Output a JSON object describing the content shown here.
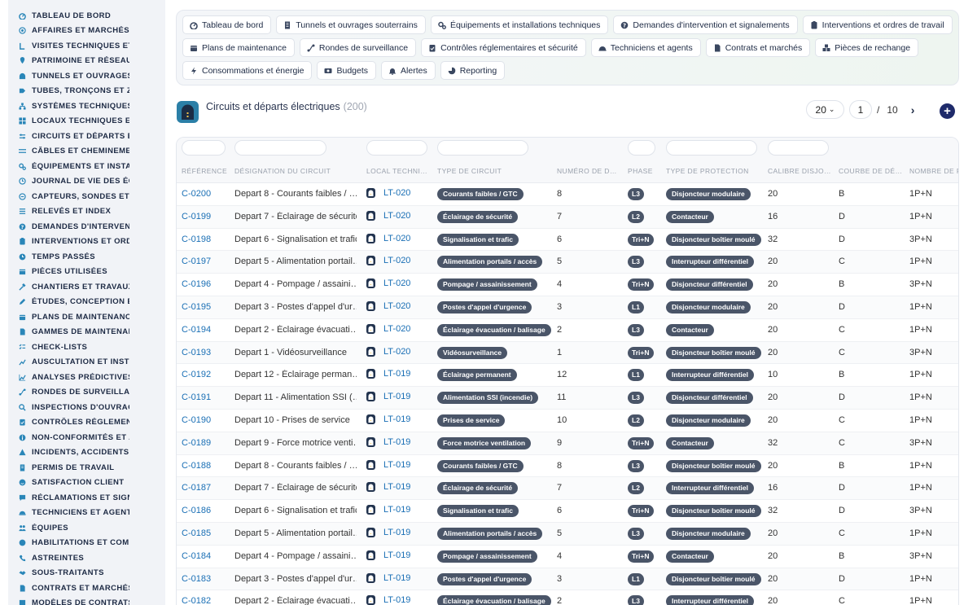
{
  "sidebar": {
    "items": [
      {
        "label": "TABLEAU DE BORD",
        "icon": "dashboard-icon"
      },
      {
        "label": "AFFAIRES ET MARCHÉS",
        "icon": "target-icon"
      },
      {
        "label": "VISITES TECHNIQUES ET",
        "icon": "footprint-icon"
      },
      {
        "label": "PATRIMOINE ET RÉSEAUX",
        "icon": "map-pin-icon"
      },
      {
        "label": "TUNNELS ET OUVRAGES",
        "icon": "tunnel-icon"
      },
      {
        "label": "TUBES, TRONÇONS ET ZO",
        "icon": "road-icon"
      },
      {
        "label": "SYSTÈMES TECHNIQUES",
        "icon": "network-icon"
      },
      {
        "label": "LOCAUX TECHNIQUES ET",
        "icon": "grid-icon"
      },
      {
        "label": "CIRCUITS ET DÉPARTS ÉL",
        "icon": "circuit-icon"
      },
      {
        "label": "CÂBLES ET CHEMINEMENT",
        "icon": "cable-icon"
      },
      {
        "label": "ÉQUIPEMENTS ET INSTAL",
        "icon": "gears-icon"
      },
      {
        "label": "JOURNAL DE VIE DES ÉQ",
        "icon": "history-icon"
      },
      {
        "label": "CAPTEURS, SONDES ET C",
        "icon": "sensor-icon"
      },
      {
        "label": "RELEVÉS ET INDEX",
        "icon": "list-icon"
      },
      {
        "label": "DEMANDES D'INTERVENT",
        "icon": "question-icon"
      },
      {
        "label": "INTERVENTIONS ET ORDR",
        "icon": "clipboard-icon"
      },
      {
        "label": "TEMPS PASSÉS",
        "icon": "clock-icon"
      },
      {
        "label": "PIÈCES UTILISÉES",
        "icon": "box-icon"
      },
      {
        "label": "CHANTIERS ET TRAVAUX",
        "icon": "hammer-icon"
      },
      {
        "label": "ÉTUDES, CONCEPTION ET",
        "icon": "pencil-icon"
      },
      {
        "label": "PLANS DE MAINTENANCE",
        "icon": "calendar-icon"
      },
      {
        "label": "GAMMES DE MAINTENANC",
        "icon": "document-icon"
      },
      {
        "label": "CHECK-LISTS",
        "icon": "checklist-icon"
      },
      {
        "label": "AUSCULTATION ET INSTR",
        "icon": "chart-icon"
      },
      {
        "label": "ANALYSES PRÉDICTIVES",
        "icon": "trend-icon"
      },
      {
        "label": "RONDES DE SURVEILLAN",
        "icon": "route-icon"
      },
      {
        "label": "INSPECTIONS D'OUVRAGE",
        "icon": "magnifier-icon"
      },
      {
        "label": "CONTRÔLES RÉGLEMENT",
        "icon": "clipboard-check-icon"
      },
      {
        "label": "NON-CONFORMITÉS ET A",
        "icon": "info-icon"
      },
      {
        "label": "INCIDENTS, ACCIDENTS E",
        "icon": "warning-icon"
      },
      {
        "label": "PERMIS DE TRAVAIL",
        "icon": "permit-icon"
      },
      {
        "label": "SATISFACTION CLIENT",
        "icon": "smile-icon"
      },
      {
        "label": "RÉCLAMATIONS ET SIGNA",
        "icon": "chat-icon"
      },
      {
        "label": "TECHNICIENS ET AGENTS",
        "icon": "helmet-icon"
      },
      {
        "label": "ÉQUIPES",
        "icon": "team-icon"
      },
      {
        "label": "HABILITATIONS ET COMP",
        "icon": "badge-icon"
      },
      {
        "label": "ASTREINTES",
        "icon": "phone-icon"
      },
      {
        "label": "SOUS-TRAITANTS",
        "icon": "handshake-icon"
      },
      {
        "label": "CONTRATS ET MARCHÉS",
        "icon": "contract-icon"
      },
      {
        "label": "MODÈLES DE CONTRATS",
        "icon": "template-icon"
      }
    ]
  },
  "topnav": {
    "rows": [
      [
        {
          "label": "Tableau de bord",
          "icon": "dashboard-icon"
        },
        {
          "label": "Tunnels et ouvrages souterrains",
          "icon": "building-icon"
        },
        {
          "label": "Équipements et installations techniques",
          "icon": "gears-icon"
        },
        {
          "label": "Demandes d'intervention et signalements",
          "icon": "question-icon"
        },
        {
          "label": "Interventions et ordres de travail",
          "icon": "clipboard-icon"
        }
      ],
      [
        {
          "label": "Plans de maintenance",
          "icon": "calendar-icon"
        },
        {
          "label": "Rondes de surveillance",
          "icon": "route-icon"
        },
        {
          "label": "Contrôles réglementaires et sécurité",
          "icon": "clipboard-check-icon"
        },
        {
          "label": "Techniciens et agents",
          "icon": "helmet-icon"
        },
        {
          "label": "Contrats et marchés",
          "icon": "contract-icon"
        },
        {
          "label": "Pièces de rechange",
          "icon": "parts-icon"
        }
      ],
      [
        {
          "label": "Consommations et énergie",
          "icon": "bolt-icon"
        },
        {
          "label": "Budgets",
          "icon": "money-icon"
        },
        {
          "label": "Alertes",
          "icon": "bell-icon"
        },
        {
          "label": "Reporting",
          "icon": "pie-icon"
        }
      ]
    ]
  },
  "page": {
    "title": "Circuits et départs électriques",
    "count": "(200)",
    "logo_icon": "tunnel-logo-icon"
  },
  "pagination": {
    "page_size": "20",
    "current_page": "1",
    "separator": "/",
    "total_pages": "10",
    "next_icon": "chevron-right-icon",
    "add_icon": "plus-circle-icon"
  },
  "table": {
    "columns": [
      "RÉFÉRENCE",
      "DÉSIGNATION DU CIRCUIT",
      "LOCAL TECHNI…",
      "TYPE DE CIRCUIT",
      "NUMÉRO DE D…",
      "PHASE",
      "TYPE DE PROTECTION",
      "CALIBRE DISJO…",
      "COURBE DE DÉ…",
      "NOMBRE DE P"
    ],
    "rows": [
      {
        "ref": "C-0200",
        "designation": "Depart 8 - Courants faibles / …",
        "local": "LT-020",
        "type": "Courants faibles / GTC",
        "num": "8",
        "phase": "L3",
        "protection": "Disjoncteur modulaire",
        "calibre": "20",
        "courbe": "B",
        "poles": "1P+N"
      },
      {
        "ref": "C-0199",
        "designation": "Depart 7 - Éclairage de sécurité",
        "local": "LT-020",
        "type": "Éclairage de sécurité",
        "num": "7",
        "phase": "L2",
        "protection": "Contacteur",
        "calibre": "16",
        "courbe": "D",
        "poles": "1P+N"
      },
      {
        "ref": "C-0198",
        "designation": "Depart 6 - Signalisation et trafic",
        "local": "LT-020",
        "type": "Signalisation et trafic",
        "num": "6",
        "phase": "Tri+N",
        "protection": "Disjoncteur boîtier moulé",
        "calibre": "32",
        "courbe": "D",
        "poles": "3P+N"
      },
      {
        "ref": "C-0197",
        "designation": "Depart 5 - Alimentation portail…",
        "local": "LT-020",
        "type": "Alimentation portails / accès",
        "num": "5",
        "phase": "L3",
        "protection": "Interrupteur différentiel",
        "calibre": "20",
        "courbe": "C",
        "poles": "1P+N"
      },
      {
        "ref": "C-0196",
        "designation": "Depart 4 - Pompage / assaini…",
        "local": "LT-020",
        "type": "Pompage / assainissement",
        "num": "4",
        "phase": "Tri+N",
        "protection": "Disjoncteur différentiel",
        "calibre": "20",
        "courbe": "B",
        "poles": "3P+N"
      },
      {
        "ref": "C-0195",
        "designation": "Depart 3 - Postes d'appel d'ur…",
        "local": "LT-020",
        "type": "Postes d'appel d'urgence",
        "num": "3",
        "phase": "L1",
        "protection": "Disjoncteur modulaire",
        "calibre": "20",
        "courbe": "D",
        "poles": "1P+N"
      },
      {
        "ref": "C-0194",
        "designation": "Depart 2 - Éclairage évacuati…",
        "local": "LT-020",
        "type": "Éclairage évacuation / balisage",
        "num": "2",
        "phase": "L3",
        "protection": "Contacteur",
        "calibre": "20",
        "courbe": "C",
        "poles": "1P+N"
      },
      {
        "ref": "C-0193",
        "designation": "Depart 1 - Vidéosurveillance",
        "local": "LT-020",
        "type": "Vidéosurveillance",
        "num": "1",
        "phase": "Tri+N",
        "protection": "Disjoncteur boîtier moulé",
        "calibre": "20",
        "courbe": "C",
        "poles": "3P+N"
      },
      {
        "ref": "C-0192",
        "designation": "Depart 12 - Éclairage perman…",
        "local": "LT-019",
        "type": "Éclairage permanent",
        "num": "12",
        "phase": "L1",
        "protection": "Interrupteur différentiel",
        "calibre": "10",
        "courbe": "B",
        "poles": "1P+N"
      },
      {
        "ref": "C-0191",
        "designation": "Depart 11 - Alimentation SSI (…",
        "local": "LT-019",
        "type": "Alimentation SSI (incendie)",
        "num": "11",
        "phase": "L3",
        "protection": "Disjoncteur différentiel",
        "calibre": "20",
        "courbe": "D",
        "poles": "1P+N"
      },
      {
        "ref": "C-0190",
        "designation": "Depart 10 - Prises de service",
        "local": "LT-019",
        "type": "Prises de service",
        "num": "10",
        "phase": "L2",
        "protection": "Disjoncteur modulaire",
        "calibre": "20",
        "courbe": "C",
        "poles": "1P+N"
      },
      {
        "ref": "C-0189",
        "designation": "Depart 9 - Force motrice venti…",
        "local": "LT-019",
        "type": "Force motrice ventilation",
        "num": "9",
        "phase": "Tri+N",
        "protection": "Contacteur",
        "calibre": "32",
        "courbe": "C",
        "poles": "3P+N"
      },
      {
        "ref": "C-0188",
        "designation": "Depart 8 - Courants faibles / …",
        "local": "LT-019",
        "type": "Courants faibles / GTC",
        "num": "8",
        "phase": "L3",
        "protection": "Disjoncteur boîtier moulé",
        "calibre": "20",
        "courbe": "B",
        "poles": "1P+N"
      },
      {
        "ref": "C-0187",
        "designation": "Depart 7 - Éclairage de sécurité",
        "local": "LT-019",
        "type": "Éclairage de sécurité",
        "num": "7",
        "phase": "L2",
        "protection": "Interrupteur différentiel",
        "calibre": "16",
        "courbe": "D",
        "poles": "1P+N"
      },
      {
        "ref": "C-0186",
        "designation": "Depart 6 - Signalisation et trafic",
        "local": "LT-019",
        "type": "Signalisation et trafic",
        "num": "6",
        "phase": "Tri+N",
        "protection": "Disjoncteur boîtier moulé",
        "calibre": "32",
        "courbe": "D",
        "poles": "3P+N"
      },
      {
        "ref": "C-0185",
        "designation": "Depart 5 - Alimentation portail…",
        "local": "LT-019",
        "type": "Alimentation portails / accès",
        "num": "5",
        "phase": "L3",
        "protection": "Disjoncteur modulaire",
        "calibre": "20",
        "courbe": "C",
        "poles": "1P+N"
      },
      {
        "ref": "C-0184",
        "designation": "Depart 4 - Pompage / assaini…",
        "local": "LT-019",
        "type": "Pompage / assainissement",
        "num": "4",
        "phase": "Tri+N",
        "protection": "Contacteur",
        "calibre": "20",
        "courbe": "B",
        "poles": "3P+N"
      },
      {
        "ref": "C-0183",
        "designation": "Depart 3 - Postes d'appel d'ur…",
        "local": "LT-019",
        "type": "Postes d'appel d'urgence",
        "num": "3",
        "phase": "L1",
        "protection": "Disjoncteur boîtier moulé",
        "calibre": "20",
        "courbe": "D",
        "poles": "1P+N"
      },
      {
        "ref": "C-0182",
        "designation": "Depart 2 - Éclairage évacuati…",
        "local": "LT-019",
        "type": "Éclairage évacuation / balisage",
        "num": "2",
        "phase": "L3",
        "protection": "Interrupteur différentiel",
        "calibre": "20",
        "courbe": "C",
        "poles": "1P+N"
      }
    ]
  },
  "colors": {
    "sidebar_bg": "#f1f3f7",
    "nav_text": "#1d2a44",
    "link": "#1a6fb5",
    "pill_bg": "#4a5568",
    "add_button": "#1e2a6a"
  }
}
